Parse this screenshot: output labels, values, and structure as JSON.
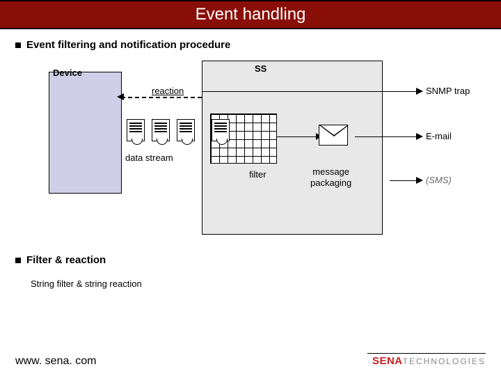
{
  "title": "Event handling",
  "section1": {
    "heading": "Event filtering and notification procedure"
  },
  "diagram": {
    "device_label": "Device",
    "ss_label": "SS",
    "reaction_label": "reaction",
    "data_stream_label": "data stream",
    "filter_label": "filter",
    "message_label_line1": "message",
    "message_label_line2": "packaging",
    "outputs": {
      "snmp": "SNMP trap",
      "email": "E-mail",
      "sms": "(SMS)"
    }
  },
  "section2": {
    "heading": "Filter & reaction",
    "sub": "String filter & string reaction"
  },
  "footer": {
    "url": "www. sena. com",
    "brand_a": "SENA",
    "brand_b": "TECHNOLOGIES"
  }
}
